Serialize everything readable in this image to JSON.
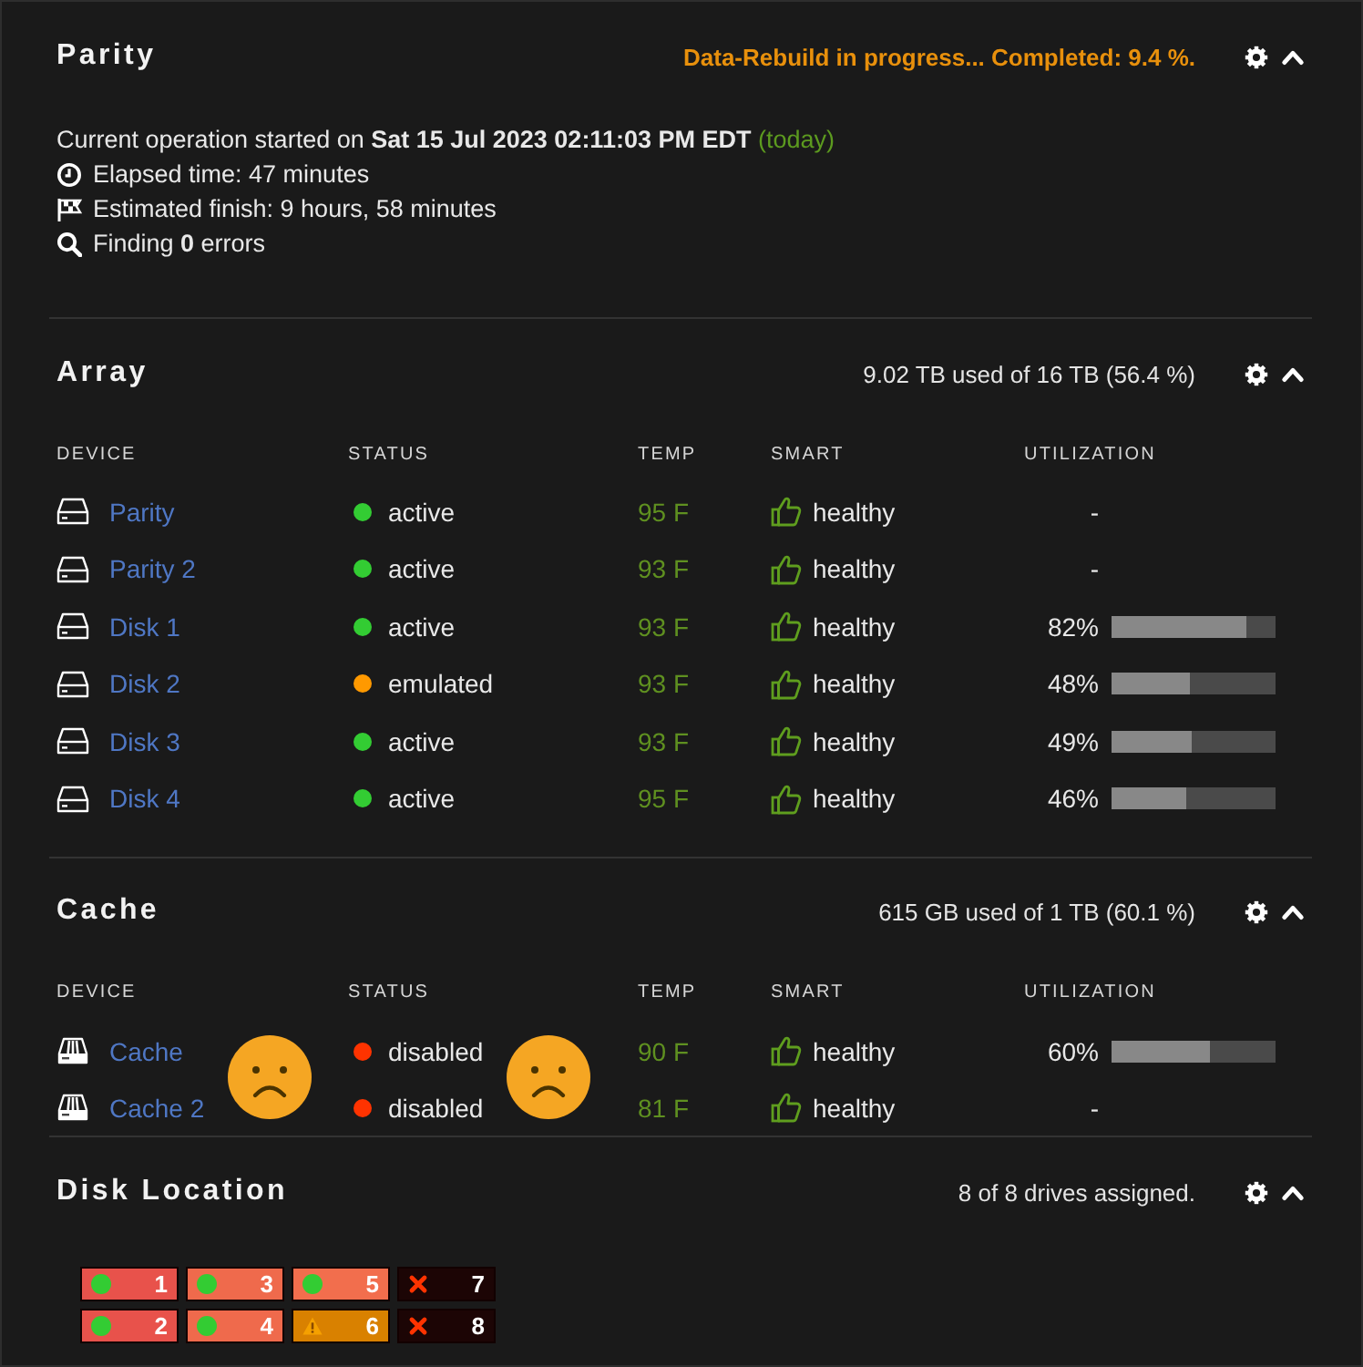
{
  "parity": {
    "title": "Parity",
    "status": "Data-Rebuild in progress... Completed: 9.4 %.",
    "lines": [
      {
        "kind": "started",
        "text": "Current operation started on **Sat 15 Jul 2023 02:11:03 PM EDT**",
        "note": "(today)"
      },
      {
        "kind": "clock",
        "text": "Elapsed time: 47 minutes"
      },
      {
        "kind": "flag",
        "text": "Estimated finish: 9 hours, 58 minutes"
      },
      {
        "kind": "search",
        "text": "Finding **0** errors"
      }
    ]
  },
  "array": {
    "title": "Array",
    "summary": "9.02 TB used of 16 TB (56.4 %)",
    "columns": [
      "DEVICE",
      "STATUS",
      "TEMP",
      "SMART",
      "UTILIZATION"
    ],
    "rows": [
      {
        "kind": "disk",
        "device": "Parity",
        "status": "active",
        "color": "#33cc33",
        "temp": "95 F",
        "smart": "healthy",
        "utilization": "-"
      },
      {
        "kind": "disk",
        "device": "Parity 2",
        "status": "active",
        "color": "#33cc33",
        "temp": "93 F",
        "smart": "healthy",
        "utilization": "-"
      },
      {
        "kind": "disk",
        "device": "Disk 1",
        "status": "active",
        "color": "#33cc33",
        "temp": "93 F",
        "smart": "healthy",
        "utilization": "82%",
        "level": 0.82
      },
      {
        "kind": "disk",
        "device": "Disk 2",
        "status": "emulated",
        "color": "#ff9900",
        "temp": "93 F",
        "smart": "healthy",
        "utilization": "48%",
        "level": 0.48
      },
      {
        "kind": "disk",
        "device": "Disk 3",
        "status": "active",
        "color": "#33cc33",
        "temp": "93 F",
        "smart": "healthy",
        "utilization": "49%",
        "level": 0.49
      },
      {
        "kind": "disk",
        "device": "Disk 4",
        "status": "active",
        "color": "#33cc33",
        "temp": "95 F",
        "smart": "healthy",
        "utilization": "46%",
        "level": 0.46
      }
    ]
  },
  "cache": {
    "title": "Cache",
    "summary": "615 GB used of 1 TB (60.1 %)",
    "columns": [
      "DEVICE",
      "STATUS",
      "TEMP",
      "SMART",
      "UTILIZATION"
    ],
    "rows": [
      {
        "kind": "ssd",
        "device": "Cache",
        "status": "disabled",
        "color": "#ff3300",
        "temp": "90 F",
        "smart": "healthy",
        "utilization": "60%",
        "level": 0.6
      },
      {
        "kind": "ssd",
        "device": "Cache 2",
        "status": "disabled",
        "color": "#ff3300",
        "temp": "81 F",
        "smart": "healthy",
        "utilization": "-"
      }
    ]
  },
  "disk_location": {
    "title": "Disk Location",
    "summary": "8 of 8 drives assigned.",
    "slots": [
      {
        "number": "1",
        "kind": "ok",
        "color": "#e8524b"
      },
      {
        "number": "2",
        "kind": "ok",
        "color": "#e8524b"
      },
      {
        "number": "3",
        "kind": "ok",
        "color": "#ef6a4c"
      },
      {
        "number": "4",
        "kind": "ok",
        "color": "#ef6a4c"
      },
      {
        "number": "5",
        "kind": "ok",
        "color": "#f26e4d"
      },
      {
        "number": "6",
        "kind": "warning",
        "color": "#d98100"
      },
      {
        "number": "7",
        "kind": "missing",
        "color": "#1c0505"
      },
      {
        "number": "8",
        "kind": "missing",
        "color": "#1c0505"
      }
    ]
  }
}
